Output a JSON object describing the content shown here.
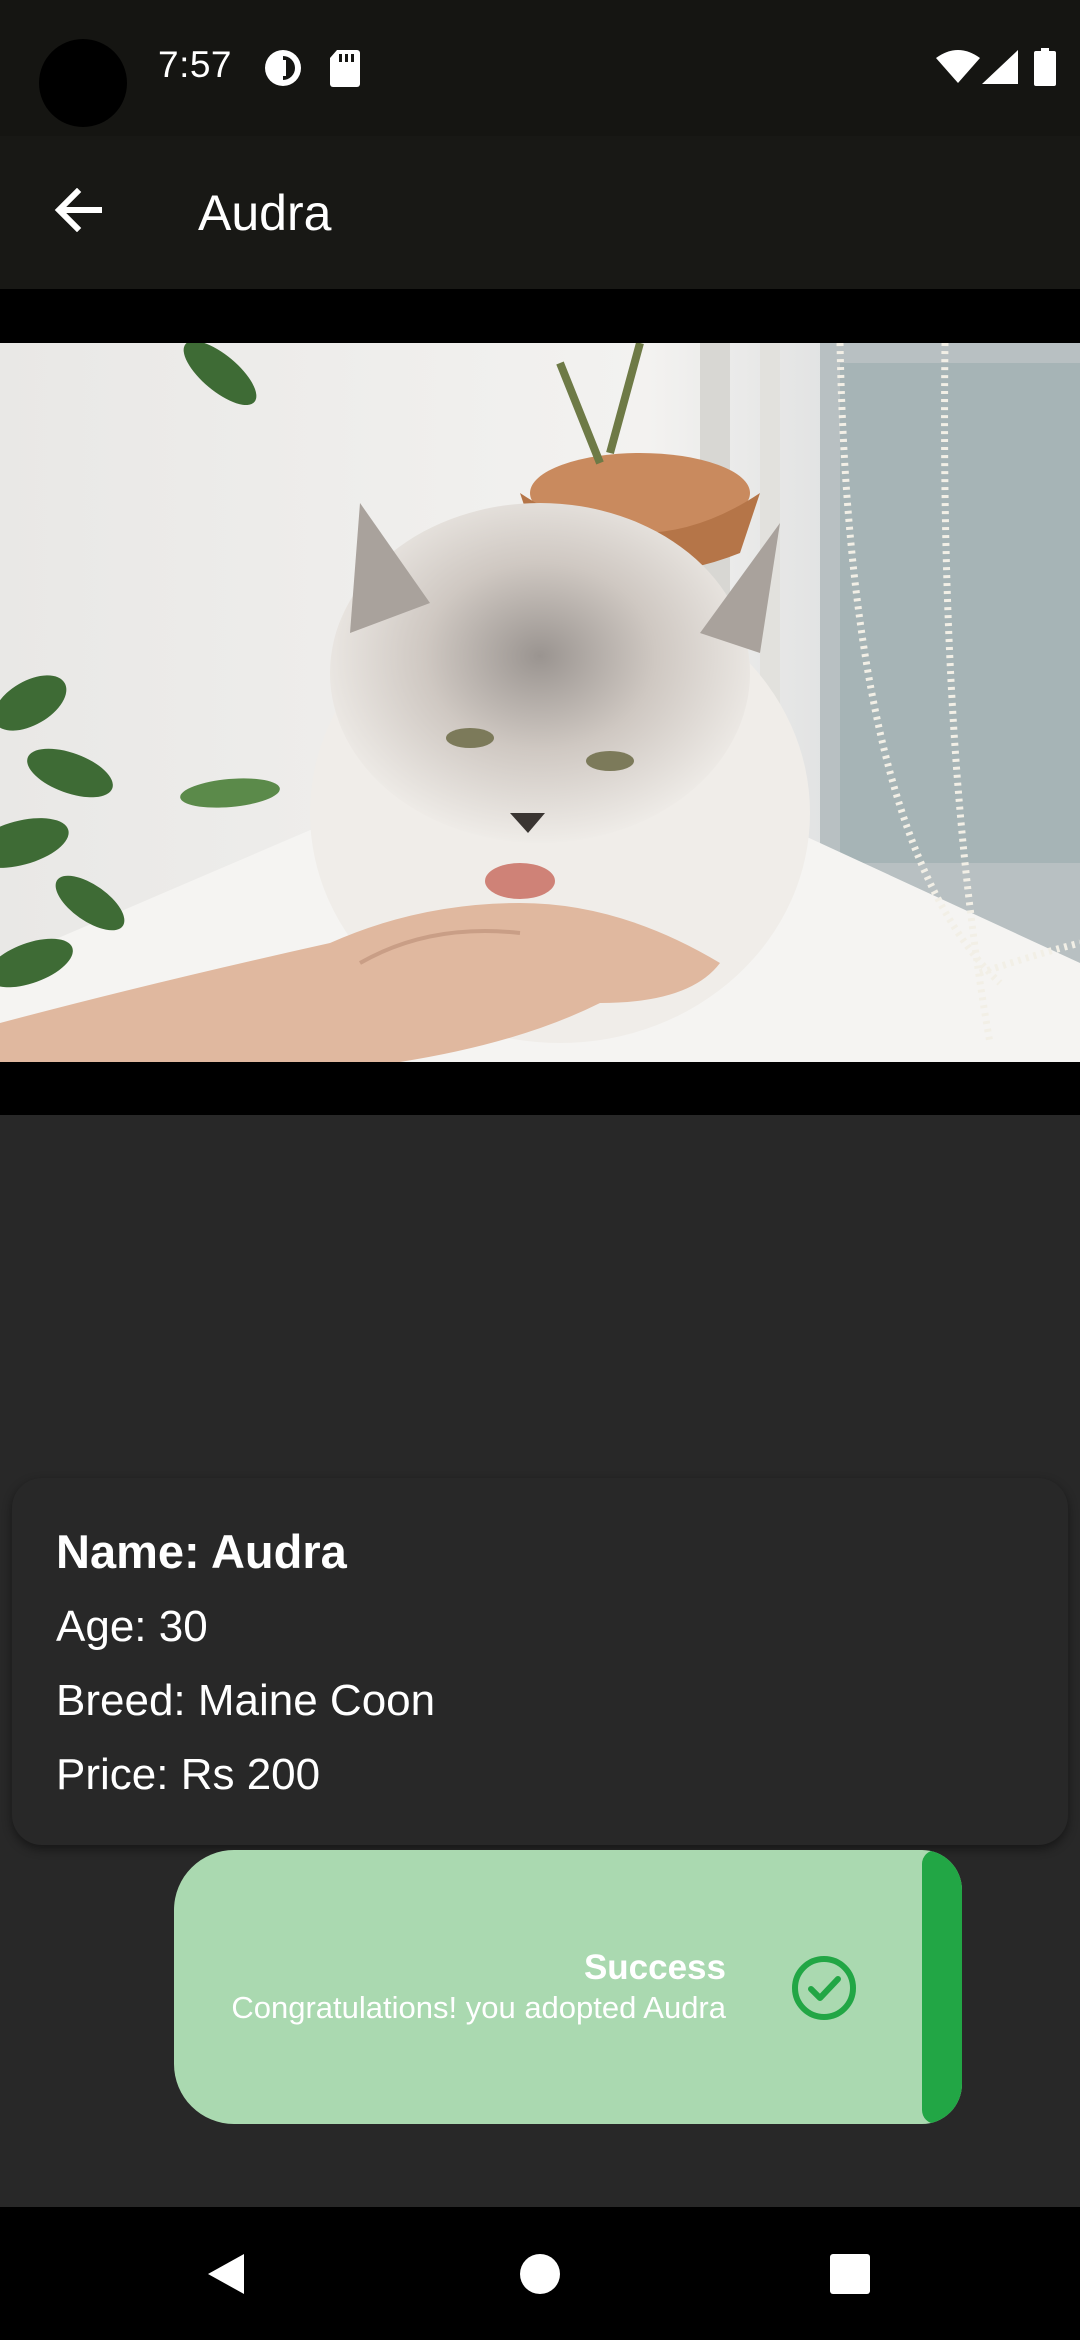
{
  "status_bar": {
    "time": "7:57",
    "icons": [
      "camera-cutout",
      "data-saver-icon",
      "sd-card-icon",
      "wifi-icon",
      "signal-icon",
      "battery-icon"
    ]
  },
  "app_bar": {
    "title": "Audra",
    "back_icon": "arrow-back-icon"
  },
  "pet": {
    "name_line": "Name: Audra",
    "age_line": "Age: 30",
    "breed_line": "Breed: Maine Coon",
    "price_line": "Price: Rs 200"
  },
  "toast": {
    "title": "Success",
    "message": "Congratulations! you adopted Audra",
    "icon": "check-circle-icon"
  },
  "colors": {
    "status_bg": "#151512",
    "app_bar_bg": "#181815",
    "page_bg": "#282828",
    "toast_bg": "#aad9b0",
    "toast_accent": "#22a645"
  },
  "nav_bar": {
    "buttons": [
      "back-triangle-icon",
      "home-circle-icon",
      "recents-square-icon"
    ]
  }
}
